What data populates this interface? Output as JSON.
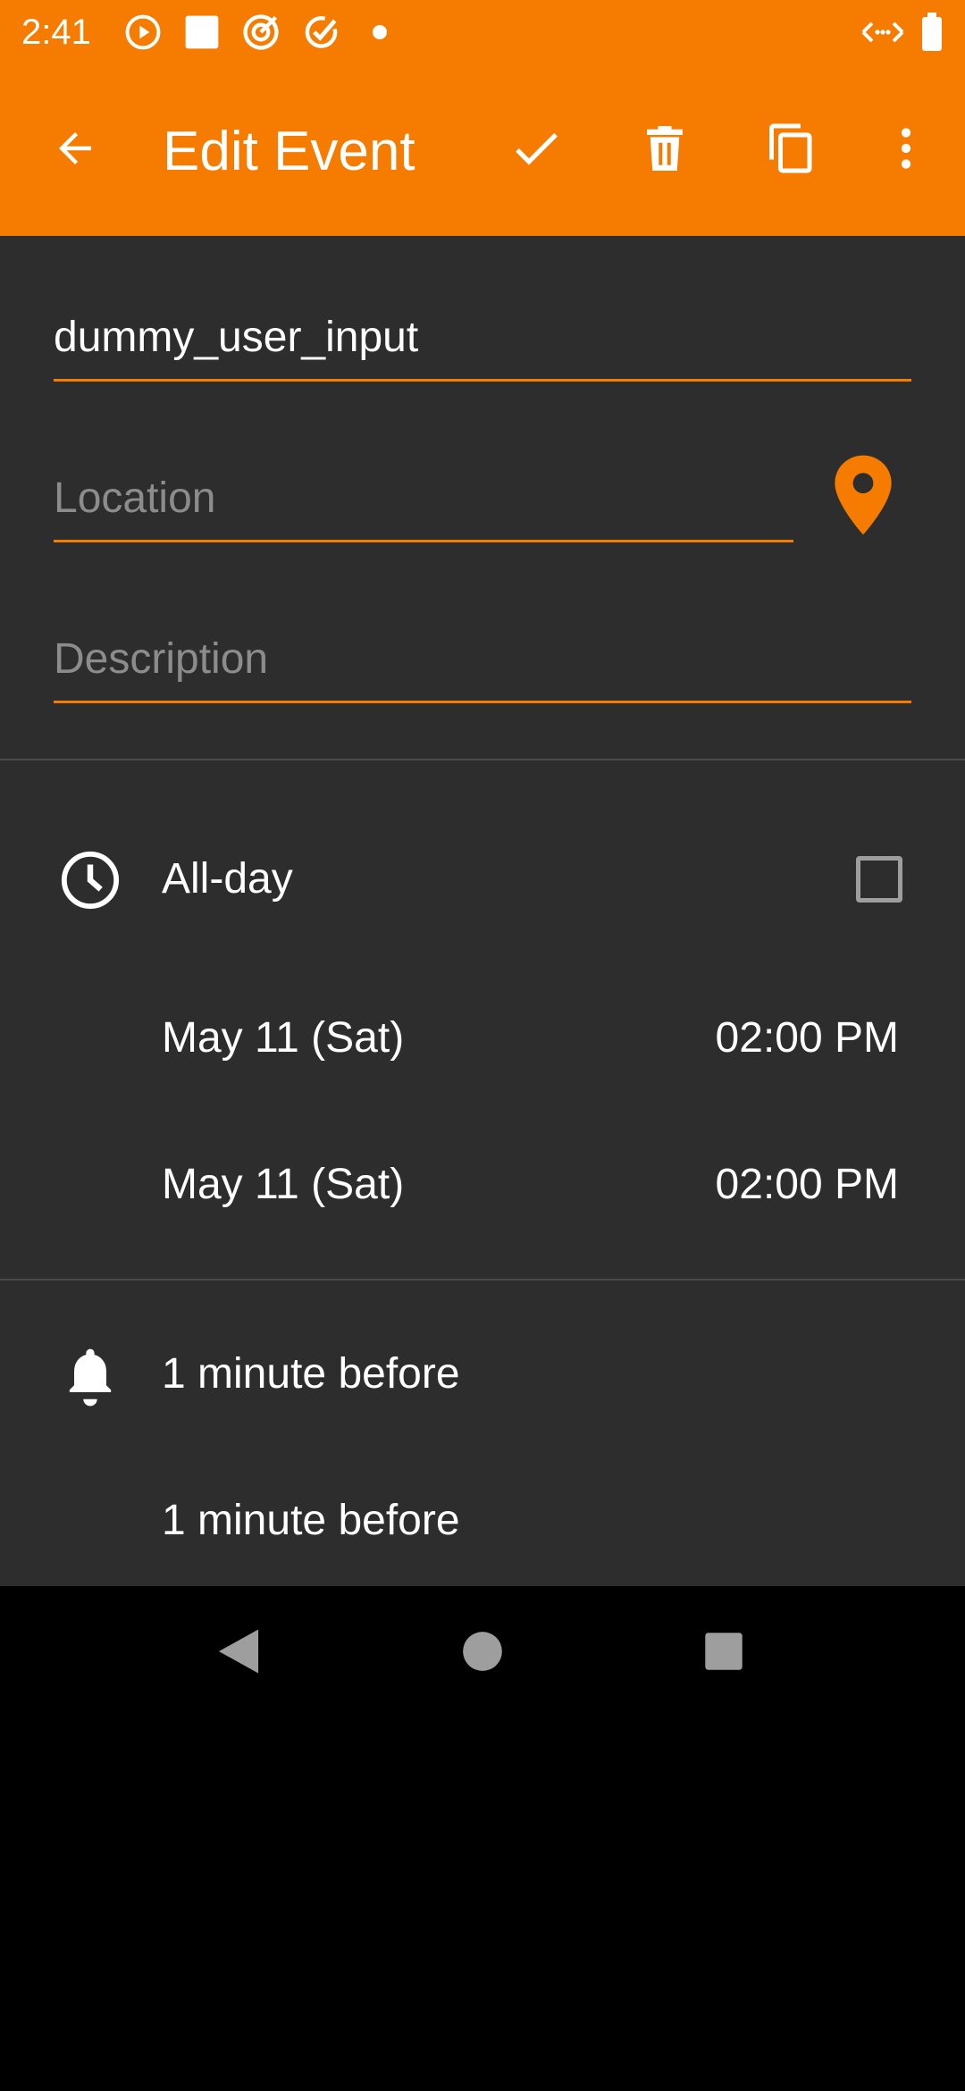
{
  "status_bar": {
    "time": "2:41",
    "icons": [
      "play-circle-icon",
      "square-icon",
      "target-icon",
      "check-badge-icon",
      "dot-icon",
      "data-arrows-icon",
      "battery-icon"
    ]
  },
  "app_bar": {
    "title": "Edit Event",
    "actions": [
      "back-arrow-icon",
      "checkmark-icon",
      "trash-icon",
      "copy-icon",
      "more-vert-icon"
    ],
    "color": "#f57c00"
  },
  "form": {
    "title_value": "dummy_user_input",
    "location_placeholder": "Location",
    "description_placeholder": "Description"
  },
  "time": {
    "allday_label": "All-day",
    "allday_checked": false,
    "start_date": "May 11 (Sat)",
    "start_time": "02:00 PM",
    "end_date": "May 11 (Sat)",
    "end_time": "02:00 PM"
  },
  "reminders": {
    "first": "1 minute before",
    "second": "1 minute before"
  }
}
